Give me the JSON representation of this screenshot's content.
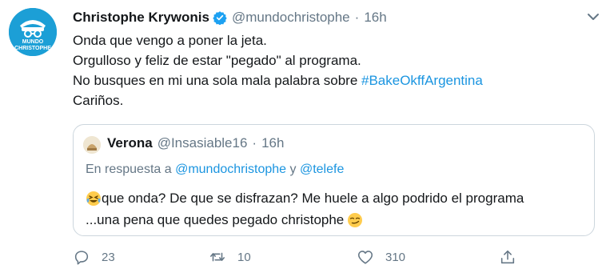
{
  "tweet": {
    "author_name": "Christophe Krywonis",
    "handle": "@mundochristophe",
    "separator": "·",
    "time": "16h",
    "avatar_icon": "mundo-christophe-logo",
    "avatar_text_1": "MUNDO",
    "avatar_text_2": "CHRISTOPHE",
    "text_lines": [
      "Onda que vengo a poner la jeta.",
      "Orgulloso y feliz de estar \"pegado\" al programa.",
      "No busques en mi una sola mala palabra sobre ",
      "Cariños."
    ],
    "hashtag": "#BakeOkffArgentina"
  },
  "quote": {
    "name": "Verona",
    "handle": "@Insasiable16",
    "separator": "·",
    "time": "16h",
    "reply_prefix": "En respuesta a ",
    "reply_user_1": "@mundochristophe",
    "reply_and": " y ",
    "reply_user_2": "@telefe",
    "line_1": "que onda? De que se disfrazan? Me huele a algo podrido el programa",
    "line_2": "...una pena que quedes pegado christophe "
  },
  "actions": {
    "reply_count": "23",
    "retweet_count": "10",
    "like_count": "310"
  },
  "colors": {
    "link": "#1b95e0",
    "muted": "#657786",
    "text": "#14171a",
    "avatar_bg": "#1c9fd6",
    "verified": "#1da1f2"
  }
}
